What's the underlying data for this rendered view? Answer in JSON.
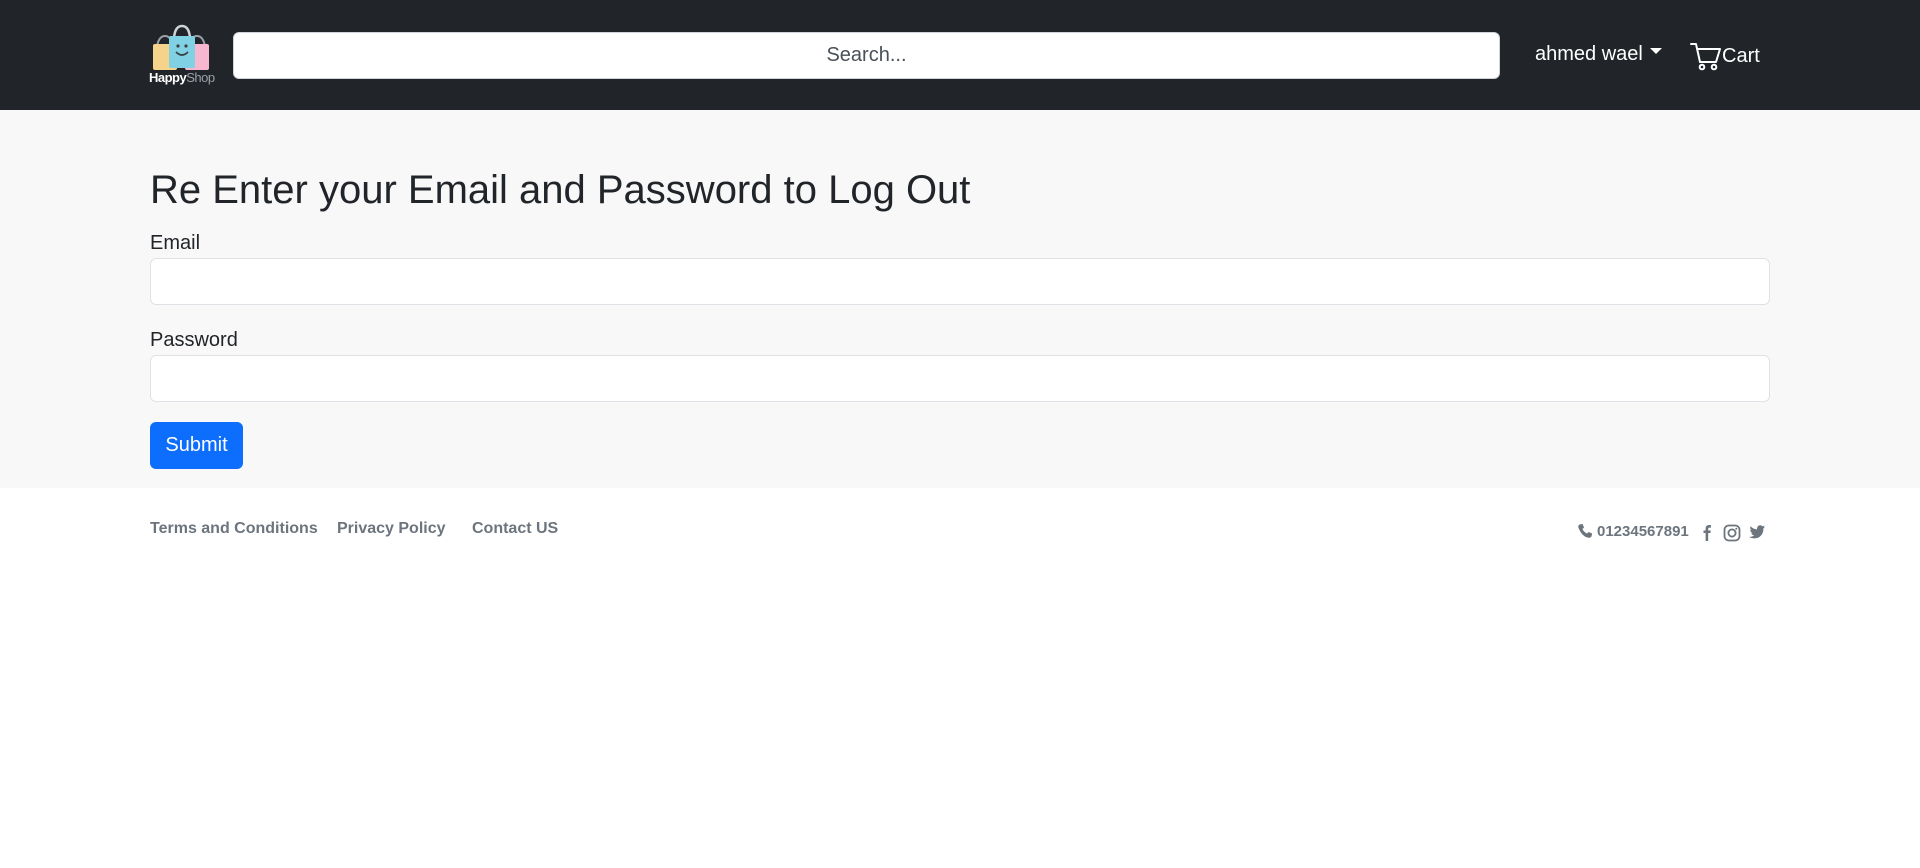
{
  "brand": {
    "name_part1": "Happy",
    "name_part2": "Shop",
    "colors": {
      "bag_left": "#f6d38a",
      "bag_middle": "#7fd1e3",
      "bag_right": "#f7b8cf"
    }
  },
  "header": {
    "search_placeholder": "Search...",
    "user_name": "ahmed wael",
    "cart_label": "Cart"
  },
  "main": {
    "title": "Re Enter your Email and Password to Log Out",
    "email_label": "Email",
    "email_value": "",
    "password_label": "Password",
    "password_value": "",
    "submit_label": "Submit"
  },
  "footer": {
    "links": [
      "Terms and Conditions",
      "Privacy Policy",
      "Contact US"
    ],
    "phone": "01234567891",
    "social_icons": [
      "facebook-icon",
      "instagram-icon",
      "twitter-icon"
    ]
  },
  "colors": {
    "navbar_bg": "#212529",
    "main_bg": "#f8f8f8",
    "primary": "#0d6efd",
    "footer_text": "#6c757d"
  }
}
